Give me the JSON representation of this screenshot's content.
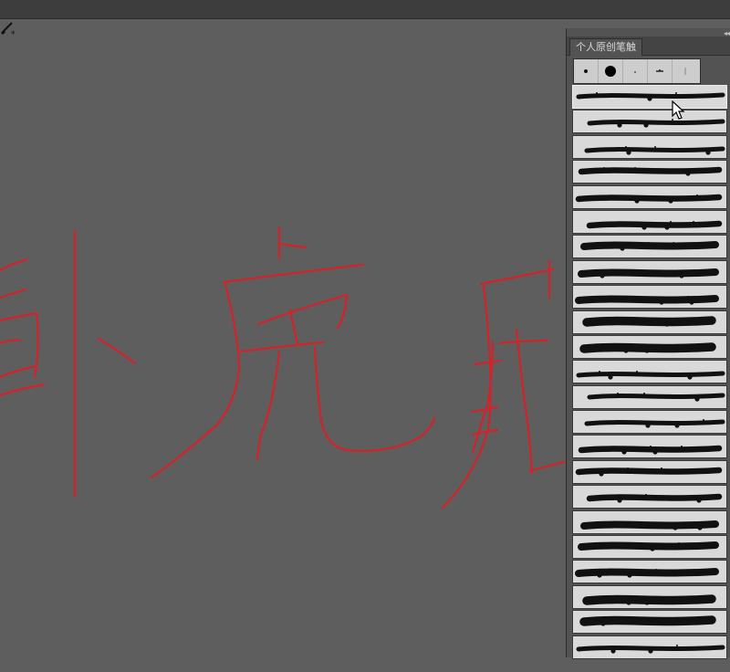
{
  "window": {
    "top_bar_color": "#3d3d3d",
    "canvas_color": "#5e5e5e"
  },
  "canvas": {
    "stroke_color": "#d3232a",
    "description_chars": [
      "卧",
      "虎",
      "藏"
    ]
  },
  "brush_panel": {
    "tab_label": "个人原创笔触",
    "collapse_glyph": "◂◂",
    "preset_icons": [
      "small-dot-brush-icon",
      "round-brush-icon",
      "tiny-dot-brush-icon",
      "spatter-brush-icon",
      "line-brush-icon"
    ],
    "brush_count": 23,
    "selected_index": 0,
    "swatch_bg": "#d9d9d9",
    "ink_color": "#111111"
  }
}
